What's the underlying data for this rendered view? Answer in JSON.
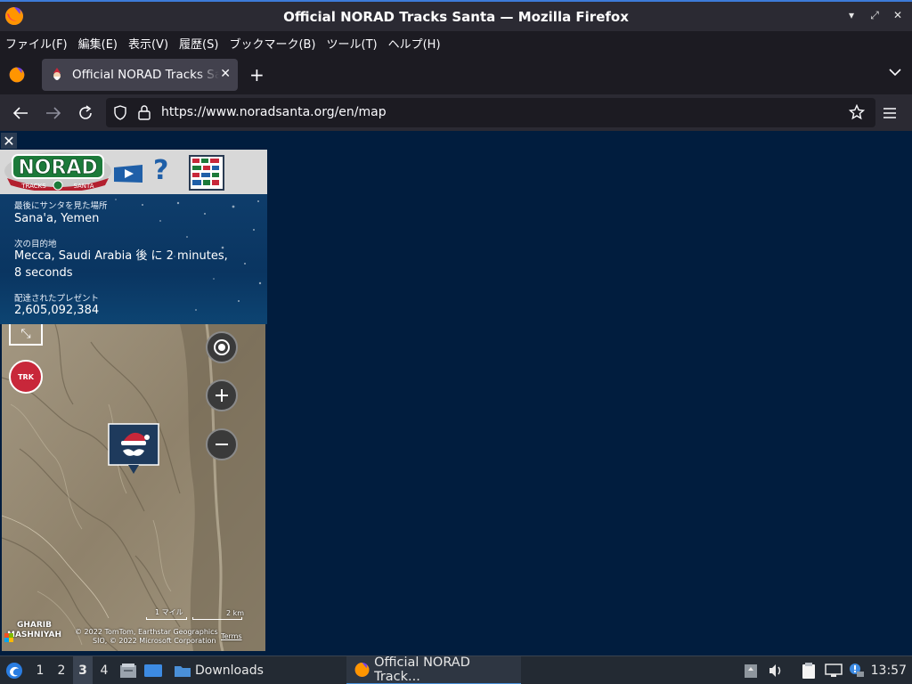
{
  "window": {
    "title": "Official NORAD Tracks Santa — Mozilla Firefox"
  },
  "menu": {
    "file": "ファイル(F)",
    "edit": "編集(E)",
    "view": "表示(V)",
    "history": "履歴(S)",
    "bookmarks": "ブックマーク(B)",
    "tools": "ツール(T)",
    "help": "ヘルプ(H)"
  },
  "tab": {
    "label": "Official NORAD Tracks Santa",
    "close": "✕",
    "new_tab": "+"
  },
  "navigation": {
    "url": "https://www.noradsanta.org/en/map"
  },
  "tracker": {
    "close": "✕",
    "help": "?",
    "last_seen_label": "最後にサンタを見た場所",
    "last_seen_value": "Sana'a, Yemen",
    "next_stop_label": "次の目的地",
    "next_stop_value": "Mecca, Saudi Arabia 後 に 2 minutes, 8 seconds",
    "presents_label": "配達されたプレゼント",
    "presents_value": "2,605,092,384"
  },
  "map": {
    "place_line1": "GHARIB",
    "place_line2": "MASHNIYAH",
    "scale_miles": "1 マイル",
    "scale_km": "2 km",
    "copyright_line1": "© 2022 TomTom, Earthstar Geographics",
    "copyright_line2": "SIO, © 2022 Microsoft Corporation",
    "terms": "Terms",
    "radar_badge": "TRK"
  },
  "taskbar": {
    "ws1": "1",
    "ws2": "2",
    "ws3": "3",
    "ws4": "4",
    "downloads": "Downloads",
    "task": "Official NORAD Track...",
    "clock": "13:57"
  },
  "colors": {
    "page_background": "#011d3e",
    "browser_chrome": "#2b2a33",
    "accent": "#3d7bd9"
  }
}
